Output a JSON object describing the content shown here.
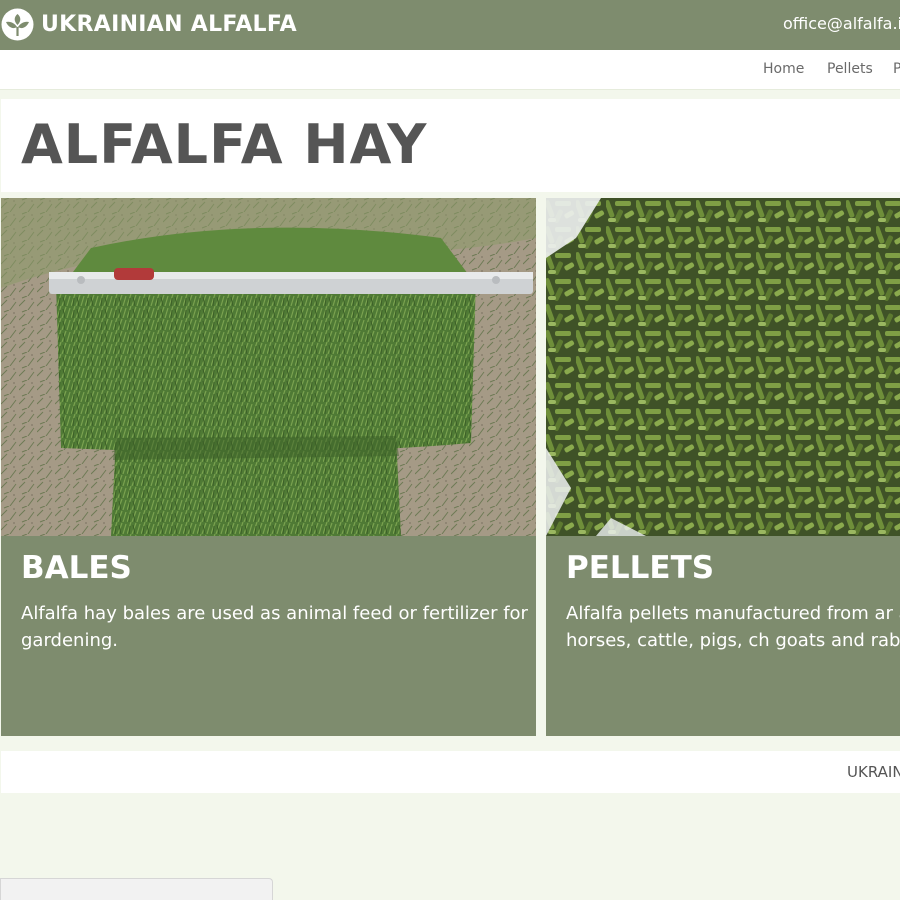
{
  "header": {
    "brand": "UKRAINIAN ALFALFA",
    "email": "office@alfalfa.in",
    "logo_icon": "leaf-logo-icon"
  },
  "nav": {
    "items": [
      {
        "label": "Home"
      },
      {
        "label": "Pellets"
      },
      {
        "label": "P"
      }
    ]
  },
  "main": {
    "title": "ALFALFA HAY"
  },
  "cards": [
    {
      "title": "BALES",
      "text": "Alfalfa hay bales are used as animal feed or fertilizer for gardening.",
      "image": "hay-bale-with-level-photo"
    },
    {
      "title": "PELLETS",
      "text": "Alfalfa pellets manufactured from ar alfalfa hay for horses, cattle, pigs, ch goats and rabbits.",
      "image": "green-alfalfa-pellets-photo"
    }
  ],
  "footer": {
    "text": "UKRAIN"
  },
  "colors": {
    "brand_green": "#7e8c6e",
    "page_bg": "#f3f7ec",
    "title_gray": "#555555",
    "nav_gray": "#6a6a6a"
  }
}
